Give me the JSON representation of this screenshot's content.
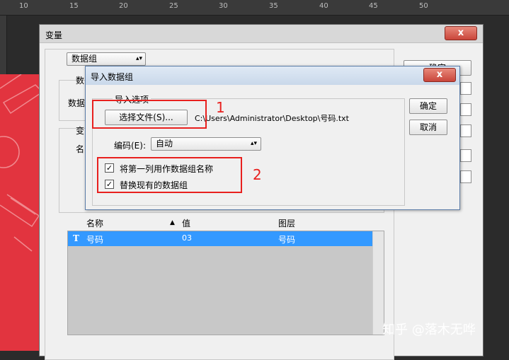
{
  "ruler": {
    "numbers": [
      "10",
      "15",
      "20",
      "25",
      "30",
      "35",
      "40",
      "45",
      "50"
    ]
  },
  "variables_dialog": {
    "title": "变量",
    "close_glyph": "x",
    "mode_select": "数据组",
    "partial_labels": [
      "数",
      "数据",
      "变",
      "名"
    ],
    "side_buttons": {
      "ok": "确定"
    },
    "table": {
      "headers": {
        "name": "名称",
        "sort_glyph": "▲",
        "value": "值",
        "layer": "图层"
      },
      "rows": [
        {
          "type_glyph": "T",
          "name": "号码",
          "value": "03",
          "layer": "号码"
        }
      ]
    }
  },
  "import_dialog": {
    "title": "导入数据组",
    "close_glyph": "x",
    "group_label": "导入选项",
    "choose_file_button": "选择文件(S)...",
    "file_path": "C:\\Users\\Administrator\\Desktop\\号码.txt",
    "encoding_label": "编码(E):",
    "encoding_value": "自动",
    "ok_button": "确定",
    "cancel_button": "取消",
    "checkboxes": [
      {
        "label": "将第一列用作数据组名称",
        "checked": true
      },
      {
        "label": "替换现有的数据组",
        "checked": true
      }
    ],
    "check_glyph": "✓"
  },
  "annotations": {
    "first": "1",
    "second": "2"
  },
  "watermark": "知乎 @落木无哗"
}
